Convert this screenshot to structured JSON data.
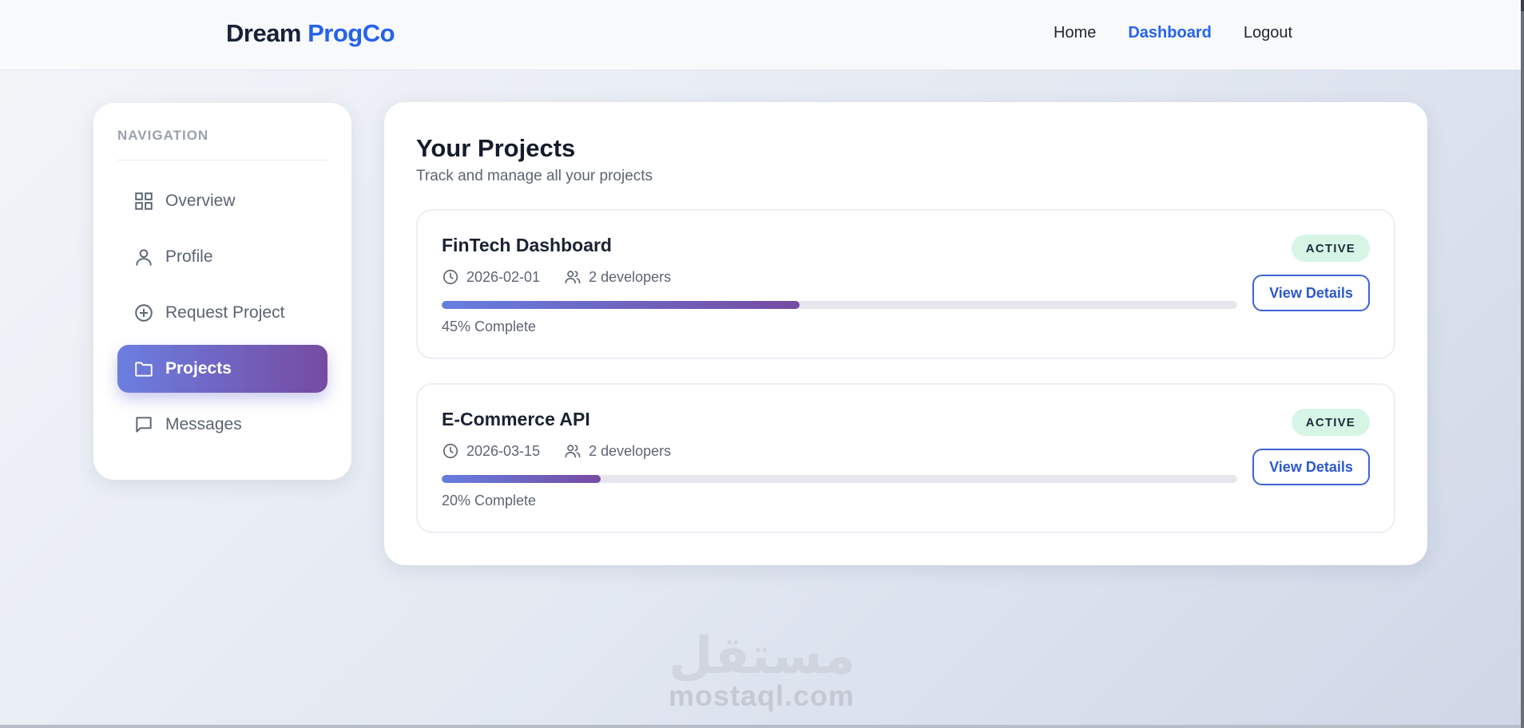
{
  "header": {
    "brand_part1": "Dream",
    "brand_part2": "ProgCo",
    "nav": [
      {
        "label": "Home"
      },
      {
        "label": "Dashboard",
        "active": true
      },
      {
        "label": "Logout"
      }
    ]
  },
  "sidebar": {
    "heading": "NAVIGATION",
    "items": [
      {
        "label": "Overview",
        "icon": "grid-icon"
      },
      {
        "label": "Profile",
        "icon": "user-icon"
      },
      {
        "label": "Request Project",
        "icon": "plus-circle-icon"
      },
      {
        "label": "Projects",
        "icon": "folder-icon",
        "active": true
      },
      {
        "label": "Messages",
        "icon": "message-icon"
      }
    ]
  },
  "main": {
    "title": "Your Projects",
    "subtitle": "Track and manage all your projects",
    "projects": [
      {
        "name": "FinTech Dashboard",
        "date": "2026-02-01",
        "developers": "2 developers",
        "progress": 45,
        "progress_label": "45% Complete",
        "status": "ACTIVE",
        "action": "View Details"
      },
      {
        "name": "E-Commerce API",
        "date": "2026-03-15",
        "developers": "2 developers",
        "progress": 20,
        "progress_label": "20% Complete",
        "status": "ACTIVE",
        "action": "View Details"
      }
    ]
  },
  "watermark": {
    "logo_text": "مستقل",
    "text": "mostaql.com"
  },
  "colors": {
    "accent": "#2563eb",
    "gradient_start": "#667eea",
    "gradient_end": "#764ba2",
    "status_bg": "#d6f5e6"
  }
}
